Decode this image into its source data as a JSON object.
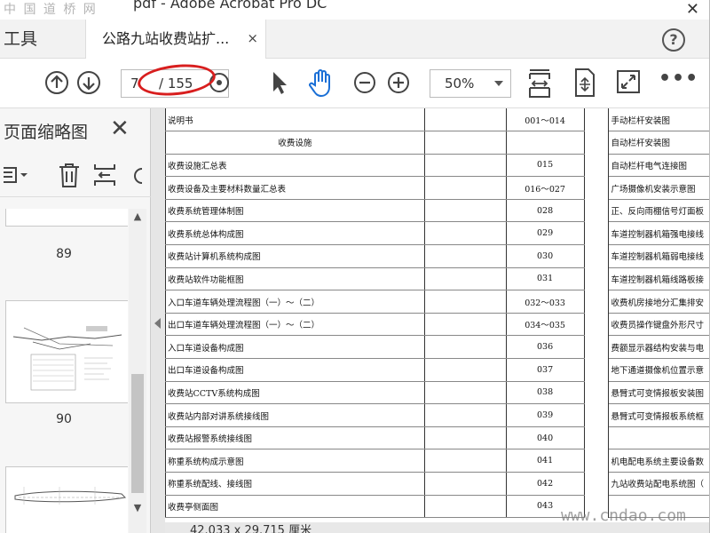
{
  "window": {
    "title_fragment": "pdf - Adobe Acrobat Pro DC",
    "watermark_top": "中 国 道 桥 网"
  },
  "tabs": {
    "tools_label": "工具",
    "doc_tab_label": "公路九站收费站扩...",
    "doc_tab_close": "×",
    "help": "?"
  },
  "toolbar": {
    "current_page": "7",
    "total_pages": "/ 155",
    "zoom_value": "50%",
    "more": "•••",
    "annotation_color": "#d81e1e"
  },
  "panel": {
    "title": "页面缩略图",
    "close": "✕",
    "thumbnails": [
      {
        "page_label": "89"
      },
      {
        "page_label": "90"
      }
    ]
  },
  "document": {
    "rows": [
      {
        "name": "说明书",
        "code": "001～014",
        "right": "手动栏杆安装图"
      },
      {
        "name": "收费设施",
        "code": "",
        "right": "自动栏杆安装图",
        "section": true
      },
      {
        "name": "收费设施汇总表",
        "code": "015",
        "right": "自动栏杆电气连接图"
      },
      {
        "name": "收费设备及主要材料数量汇总表",
        "code": "016～027",
        "right": "广场摄像机安装示意图"
      },
      {
        "name": "收费系统管理体制图",
        "code": "028",
        "right": "正、反向雨棚信号灯面板"
      },
      {
        "name": "收费系统总体构成图",
        "code": "029",
        "right": "车道控制器机箱强电接线"
      },
      {
        "name": "收费站计算机系统构成图",
        "code": "030",
        "right": "车道控制器机箱弱电接线"
      },
      {
        "name": "收费站软件功能框图",
        "code": "031",
        "right": "车道控制器机箱线路板接"
      },
      {
        "name": "入口车道车辆处理流程图（一）～（二）",
        "code": "032～033",
        "right": "收费机房接地分汇集排安"
      },
      {
        "name": "出口车道车辆处理流程图（一）～（二）",
        "code": "034～035",
        "right": "收费员操作键盘外形尺寸"
      },
      {
        "name": "入口车道设备构成图",
        "code": "036",
        "right": "费额显示器结构安装与电"
      },
      {
        "name": "出口车道设备构成图",
        "code": "037",
        "right": "地下通道摄像机位置示意"
      },
      {
        "name": "收费站CCTV系统构成图",
        "code": "038",
        "right": "悬臂式可变情报板安装图"
      },
      {
        "name": "收费站内部对讲系统接线图",
        "code": "039",
        "right": "悬臂式可变情报板系统框"
      },
      {
        "name": "收费站报警系统接线图",
        "code": "040",
        "right": ""
      },
      {
        "name": "称重系统构成示意图",
        "code": "041",
        "right": "机电配电系统主要设备数"
      },
      {
        "name": "称重系统配线、接线图",
        "code": "042",
        "right": "九站收费站配电系统图（"
      },
      {
        "name": "收费亭侧面图",
        "code": "043",
        "right": ""
      }
    ],
    "page_dimensions": "42.033 x 29.715 厘米",
    "site_watermark": "www.cndao.com"
  }
}
